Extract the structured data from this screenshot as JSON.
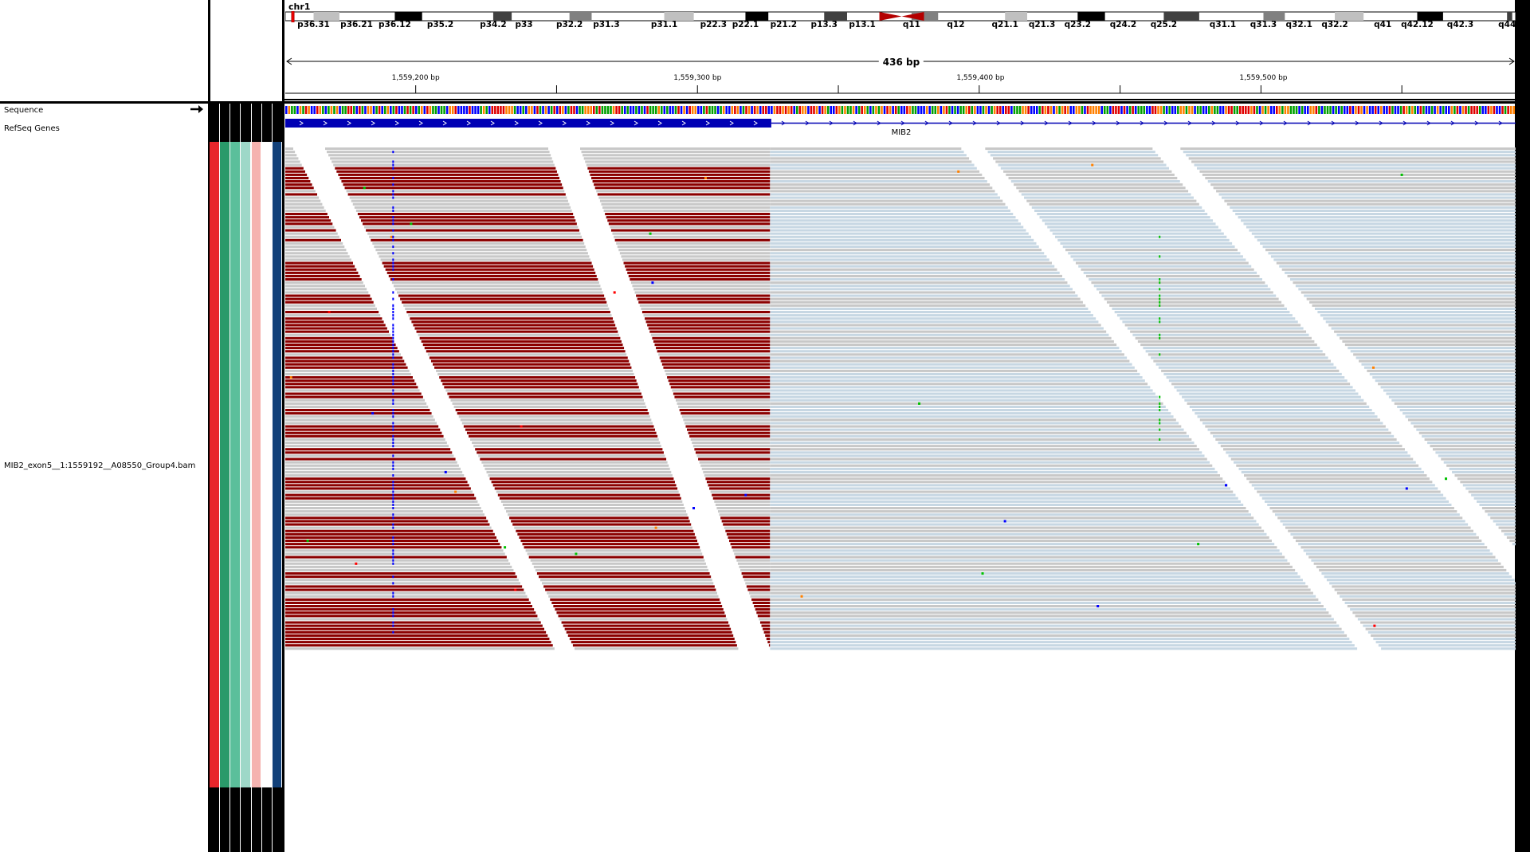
{
  "header": {
    "chromosome": "chr1",
    "span_label": "436 bp"
  },
  "ideogram": {
    "bands": [
      {
        "label": "p36.31",
        "pos": 0.023
      },
      {
        "label": "p36.21",
        "pos": 0.058
      },
      {
        "label": "p36.12",
        "pos": 0.089
      },
      {
        "label": "p35.2",
        "pos": 0.126
      },
      {
        "label": "p34.2",
        "pos": 0.169
      },
      {
        "label": "p33",
        "pos": 0.194
      },
      {
        "label": "p32.2",
        "pos": 0.231
      },
      {
        "label": "p31.3",
        "pos": 0.261
      },
      {
        "label": "p31.1",
        "pos": 0.308
      },
      {
        "label": "p22.3",
        "pos": 0.348
      },
      {
        "label": "p22.1",
        "pos": 0.374
      },
      {
        "label": "p21.2",
        "pos": 0.405
      },
      {
        "label": "p13.3",
        "pos": 0.438
      },
      {
        "label": "p13.1",
        "pos": 0.469
      },
      {
        "label": "q11",
        "pos": 0.509
      },
      {
        "label": "q12",
        "pos": 0.545
      },
      {
        "label": "q21.1",
        "pos": 0.585
      },
      {
        "label": "q21.3",
        "pos": 0.615
      },
      {
        "label": "q23.2",
        "pos": 0.644
      },
      {
        "label": "q24.2",
        "pos": 0.681
      },
      {
        "label": "q25.2",
        "pos": 0.714
      },
      {
        "label": "q31.1",
        "pos": 0.762
      },
      {
        "label": "q31.3",
        "pos": 0.795
      },
      {
        "label": "q32.1",
        "pos": 0.824
      },
      {
        "label": "q32.2",
        "pos": 0.853
      },
      {
        "label": "q41",
        "pos": 0.892
      },
      {
        "label": "q42.12",
        "pos": 0.92
      },
      {
        "label": "q42.3",
        "pos": 0.955
      },
      {
        "label": "q44",
        "pos": 0.993
      }
    ]
  },
  "ruler": {
    "ticks": [
      {
        "label": "1,559,200 bp",
        "pos": 0.106
      },
      {
        "label": "1,559,300 bp",
        "pos": 0.335
      },
      {
        "label": "1,559,400 bp",
        "pos": 0.565
      },
      {
        "label": "1,559,500 bp",
        "pos": 0.795
      }
    ]
  },
  "tracks": {
    "sequence_label": "Sequence",
    "refseq_label": "RefSeq Genes",
    "gene_name": "MIB2",
    "bam_label": "MIB2_exon5__1:1559192__A08550_Group4.bam"
  },
  "colors": {
    "red_read": "#8b0000",
    "gray_read": "#c8c8c8",
    "blue_read": "#c7d7e3",
    "gene_blue": "#0000b4",
    "variant_blue": "#0000ff"
  },
  "attributes": {
    "colors": [
      "#e8262b",
      "#2a9a6a",
      "#5bbf9b",
      "#9ed8c8",
      "#f5b3b0",
      "#ffffff",
      "#12417a"
    ]
  }
}
